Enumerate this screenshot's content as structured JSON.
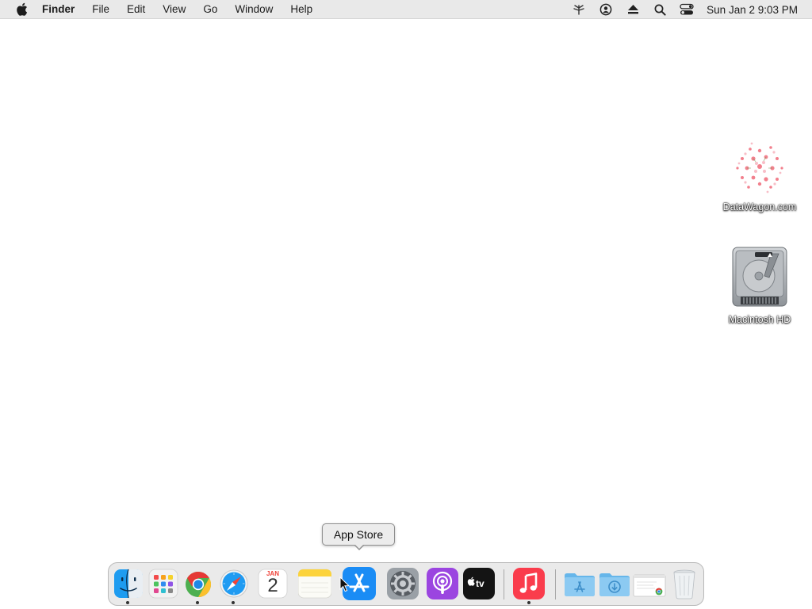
{
  "menubar": {
    "app_name": "Finder",
    "items": [
      "File",
      "Edit",
      "View",
      "Go",
      "Window",
      "Help"
    ],
    "status_icons": [
      "network-icon",
      "user-icon",
      "eject-icon",
      "search-icon",
      "control-center-icon"
    ],
    "clock": "Sun Jan 2  9:03 PM"
  },
  "desktop": {
    "icons": [
      {
        "label": "DataWagon.com",
        "icon": "floral-image-icon"
      },
      {
        "label": "Macintosh HD",
        "icon": "hard-drive-icon"
      }
    ]
  },
  "tooltip": {
    "text": "App Store"
  },
  "dock": {
    "calendar": {
      "month": "JAN",
      "day": "2"
    },
    "items": [
      {
        "name": "Finder",
        "running": true
      },
      {
        "name": "Launchpad",
        "running": false
      },
      {
        "name": "Google Chrome",
        "running": true
      },
      {
        "name": "Safari",
        "running": true
      },
      {
        "name": "Calendar",
        "running": false
      },
      {
        "name": "Notes",
        "running": false
      },
      {
        "name": "App Store",
        "running": false
      },
      {
        "name": "System Preferences",
        "running": false
      },
      {
        "name": "Podcasts",
        "running": false
      },
      {
        "name": "TV",
        "running": false
      },
      {
        "name": "Music",
        "running": true
      },
      {
        "name": "Applications",
        "running": false
      },
      {
        "name": "Downloads",
        "running": false
      },
      {
        "name": "Recent Document",
        "running": false
      },
      {
        "name": "Trash",
        "running": false
      }
    ]
  },
  "colors": {
    "menubar_bg": "#e9e9e9",
    "desktop_bg": "#ffffff",
    "appstore_blue": "#1a8cf5",
    "music_red": "#fa3c4c",
    "podcasts_purple": "#9b45e0"
  }
}
